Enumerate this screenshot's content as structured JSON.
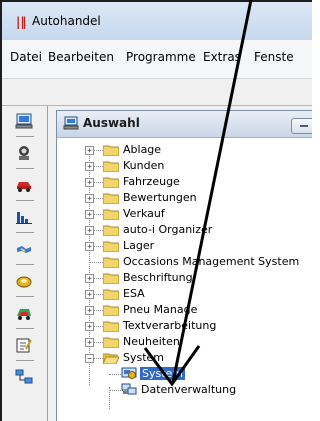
{
  "window": {
    "title": "Autohandel",
    "app_icon": "app-logo-icon"
  },
  "menubar": {
    "items": [
      "Datei",
      "Bearbeiten",
      "Programme",
      "Extras",
      "Fenste"
    ]
  },
  "left_toolbar": {
    "buttons": [
      {
        "name": "computer-icon"
      },
      {
        "name": "customer-icon"
      },
      {
        "name": "car-icon"
      },
      {
        "name": "bar-chart-icon"
      },
      {
        "name": "handshake-icon"
      },
      {
        "name": "parts-icon"
      },
      {
        "name": "car-colored-icon"
      },
      {
        "name": "note-edit-icon"
      },
      {
        "name": "network-icon"
      }
    ]
  },
  "child_window": {
    "title": "Auswahl",
    "title_icon": "computer-icon"
  },
  "tree": {
    "nodes": [
      {
        "label": "Ablage",
        "expandable": true,
        "level": 0
      },
      {
        "label": "Kunden",
        "expandable": true,
        "level": 0
      },
      {
        "label": "Fahrzeuge",
        "expandable": true,
        "level": 0
      },
      {
        "label": "Bewertungen",
        "expandable": true,
        "level": 0
      },
      {
        "label": "Verkauf",
        "expandable": true,
        "level": 0
      },
      {
        "label": "auto-i Organizer",
        "expandable": true,
        "level": 0
      },
      {
        "label": "Lager",
        "expandable": true,
        "level": 0
      },
      {
        "label": "Occasions Management System",
        "expandable": false,
        "level": 0
      },
      {
        "label": "Beschriftung",
        "expandable": true,
        "level": 0
      },
      {
        "label": "ESA",
        "expandable": true,
        "level": 0
      },
      {
        "label": "Pneu Manage",
        "expandable": true,
        "level": 0
      },
      {
        "label": "Textverarbeitung",
        "expandable": true,
        "level": 0
      },
      {
        "label": "Neuheiten",
        "expandable": true,
        "level": 0
      },
      {
        "label": "System",
        "expandable": true,
        "expanded": true,
        "level": 0
      },
      {
        "label": "System",
        "expandable": false,
        "level": 1,
        "selected": true
      },
      {
        "label": "Datenverwaltung",
        "expandable": false,
        "level": 1
      }
    ]
  },
  "colors": {
    "selection": "#3169c6",
    "folder": "#f2d46b",
    "arrow": "#000000"
  }
}
